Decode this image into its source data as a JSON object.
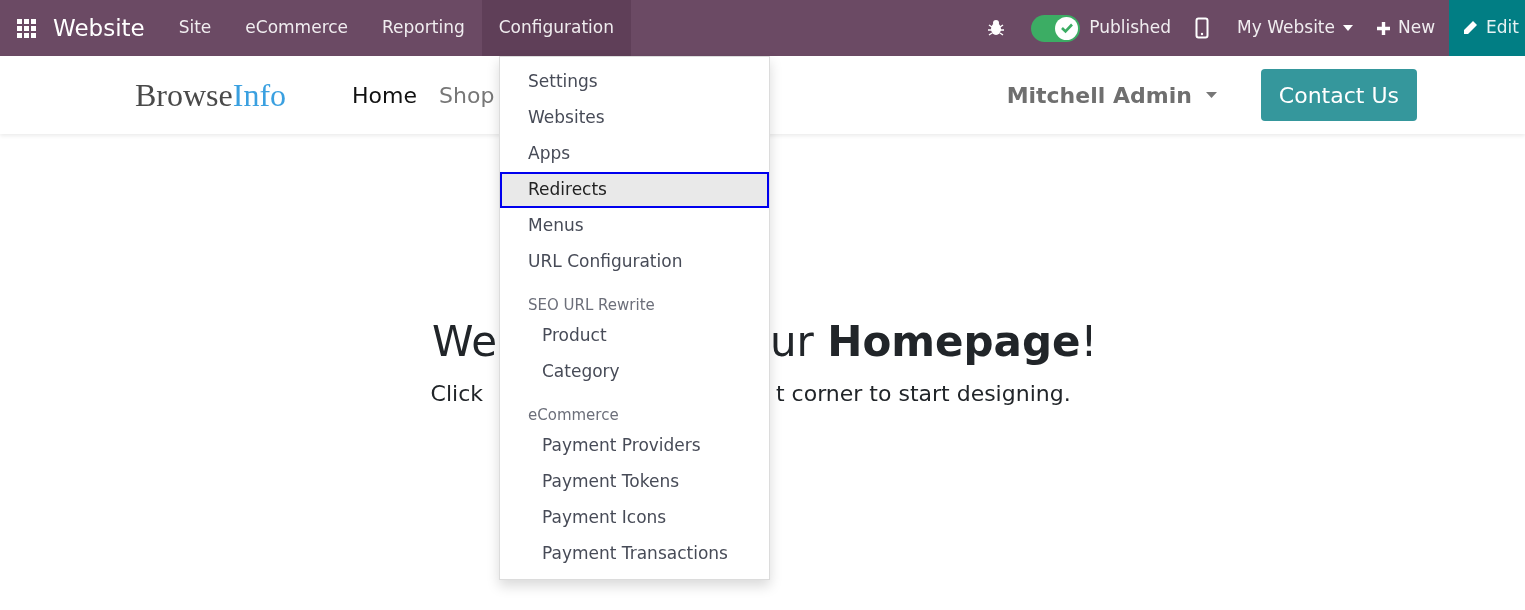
{
  "topbar": {
    "app_title": "Website",
    "menus": [
      {
        "label": "Site",
        "selected": false
      },
      {
        "label": "eCommerce",
        "selected": false
      },
      {
        "label": "Reporting",
        "selected": false
      },
      {
        "label": "Configuration",
        "selected": true
      }
    ],
    "published": {
      "label": "Published",
      "on": true
    },
    "website_selector": "My Website",
    "new_label": "New",
    "edit_label": "Edit"
  },
  "site_header": {
    "logo_part1": "Browse",
    "logo_part2": "Info",
    "nav": [
      {
        "label": "Home",
        "selected": true
      },
      {
        "label": "Shop",
        "selected": false
      }
    ],
    "user": "Mitchell Admin",
    "contact_button": "Contact Us"
  },
  "hero": {
    "heading_left": "We",
    "heading_right": "ur **Homepage**!",
    "subtitle_left": "Click",
    "subtitle_right": "t corner to start designing."
  },
  "dropdown": [
    {
      "kind": "item",
      "label": "Settings",
      "selected": false
    },
    {
      "kind": "item",
      "label": "Websites",
      "selected": false
    },
    {
      "kind": "item",
      "label": "Apps",
      "selected": false
    },
    {
      "kind": "item",
      "label": "Redirects",
      "selected": true
    },
    {
      "kind": "item",
      "label": "Menus",
      "selected": false
    },
    {
      "kind": "item",
      "label": "URL Configuration",
      "selected": false
    },
    {
      "kind": "header",
      "label": "SEO URL Rewrite"
    },
    {
      "kind": "subitem",
      "label": "Product",
      "selected": false
    },
    {
      "kind": "subitem",
      "label": "Category",
      "selected": false
    },
    {
      "kind": "header",
      "label": "eCommerce"
    },
    {
      "kind": "subitem",
      "label": "Payment Providers",
      "selected": false
    },
    {
      "kind": "subitem",
      "label": "Payment Tokens",
      "selected": false
    },
    {
      "kind": "subitem",
      "label": "Payment Icons",
      "selected": false
    },
    {
      "kind": "subitem",
      "label": "Payment Transactions",
      "selected": false
    }
  ]
}
